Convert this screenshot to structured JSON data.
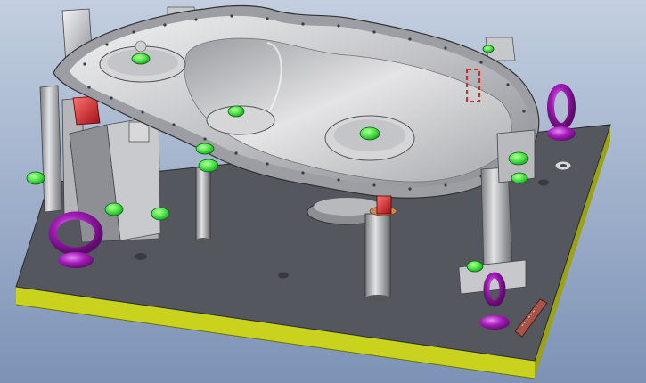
{
  "viewport": {
    "description_label": "",
    "background_top": "#b8c6da",
    "background_bottom": "#7f95b8"
  },
  "colors": {
    "base_top": "#545660",
    "base_side": "#c8d21c",
    "base_side_dark": "#9aa114",
    "metal_light": "#e8e8ea",
    "metal_mid": "#b4b5b9",
    "metal_dark": "#6d6e74",
    "pin_green": "#49e246",
    "clamp_red": "#e0262a",
    "eyebolt_purple": "#a21ab4",
    "pin_copper": "#b87a4c",
    "nameplate": "#a45248"
  },
  "nameplate": {
    "text": "",
    "icon": "nameplate-icon"
  }
}
